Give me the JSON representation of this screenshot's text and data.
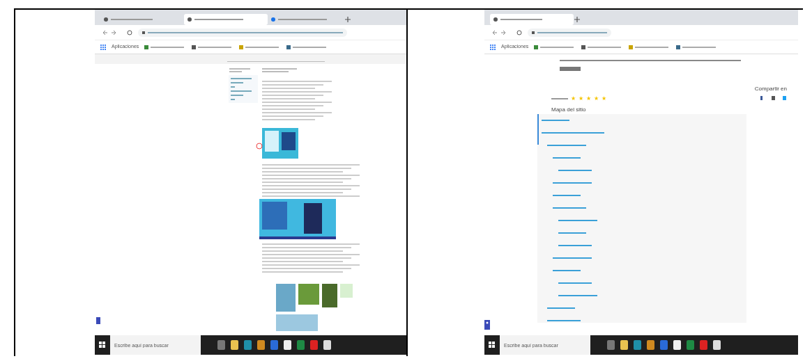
{
  "screenshots": [
    {
      "kind": "article",
      "bookmarks_label": "Aplicaciones",
      "taskbar_search": {
        "placeholder": "Escribe aquí para buscar"
      }
    },
    {
      "kind": "sitemap",
      "bookmarks_label": "Aplicaciones",
      "rating": {
        "stars": 5
      },
      "share_label": "Compartir en",
      "sitemap_title": "Mapa del sitio",
      "taskbar_search": {
        "placeholder": "Escribe aquí para buscar"
      }
    }
  ]
}
